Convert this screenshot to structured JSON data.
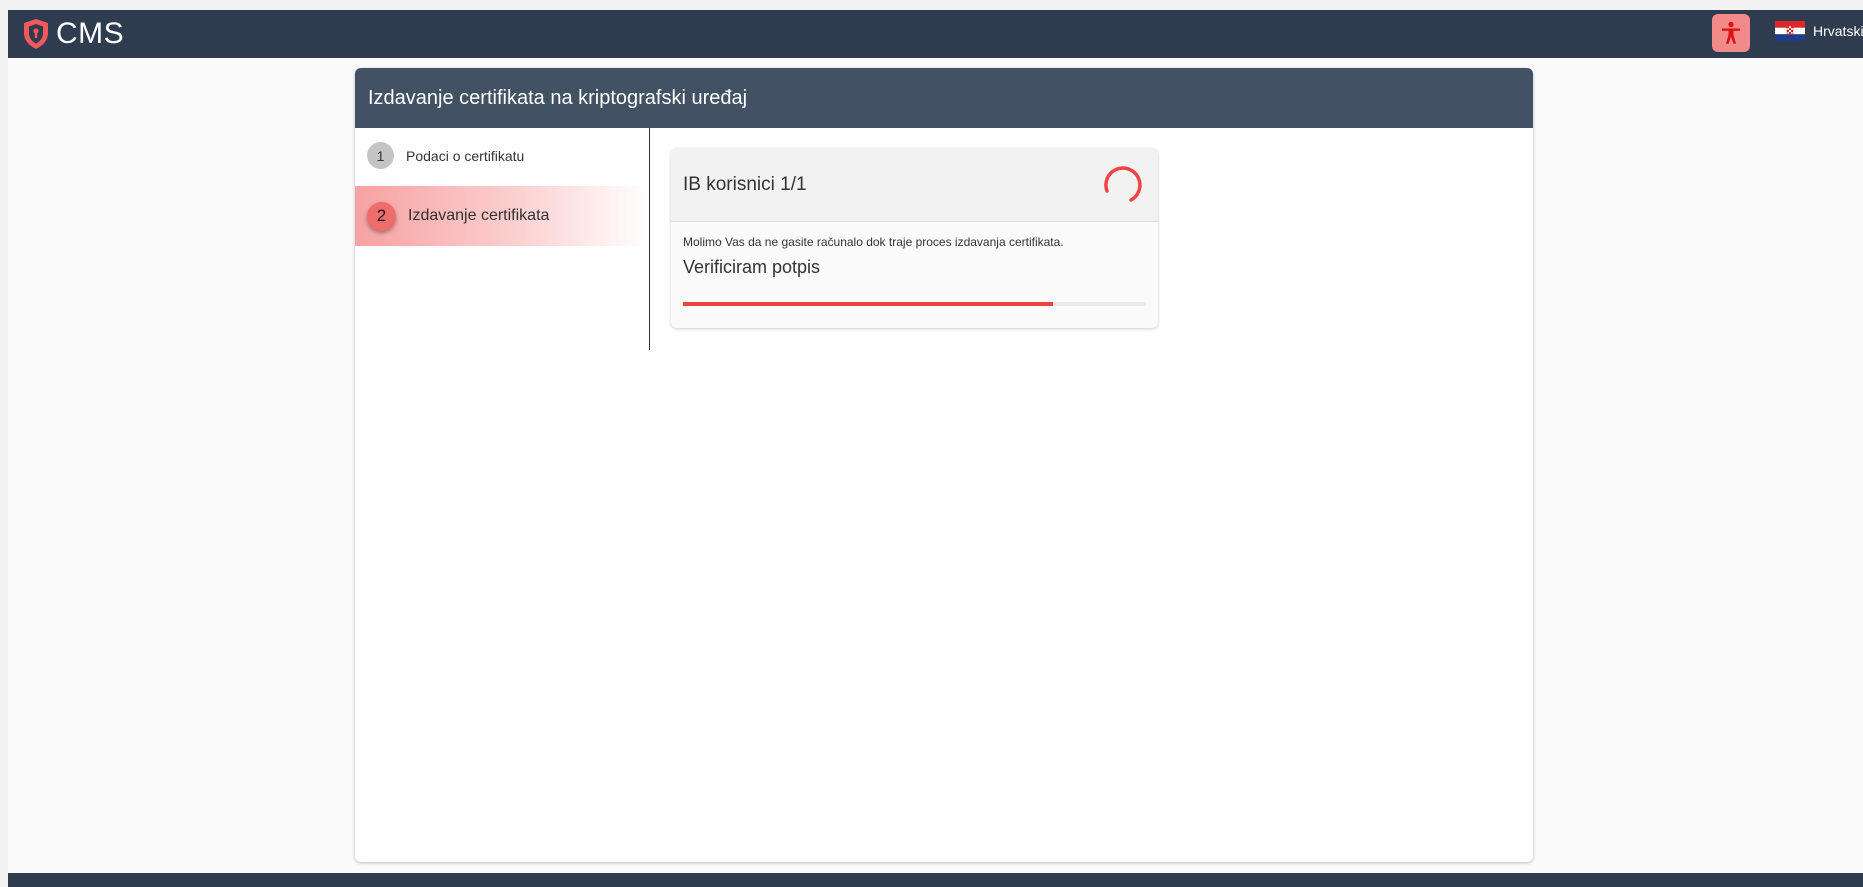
{
  "app": {
    "name": "CMS"
  },
  "header": {
    "language_label": "Hrvatski"
  },
  "card": {
    "title": "Izdavanje certifikata na kriptografski uređaj"
  },
  "steps": [
    {
      "number": "1",
      "label": "Podaci o certifikatu",
      "active": false
    },
    {
      "number": "2",
      "label": "Izdavanje certifikata",
      "active": true
    }
  ],
  "progress": {
    "title": "IB korisnici 1/1",
    "message": "Molimo Vas da ne gasite računalo dok traje proces izdavanja certifikata.",
    "status": "Verificiram potpis",
    "percent": 80
  },
  "colors": {
    "accent": "#ef4444",
    "topbar": "#2f3b4f",
    "card_header": "#425164"
  },
  "icons": {
    "logo": "shield-icon",
    "accessibility": "accessibility-icon",
    "language": "croatian-flag-icon"
  }
}
